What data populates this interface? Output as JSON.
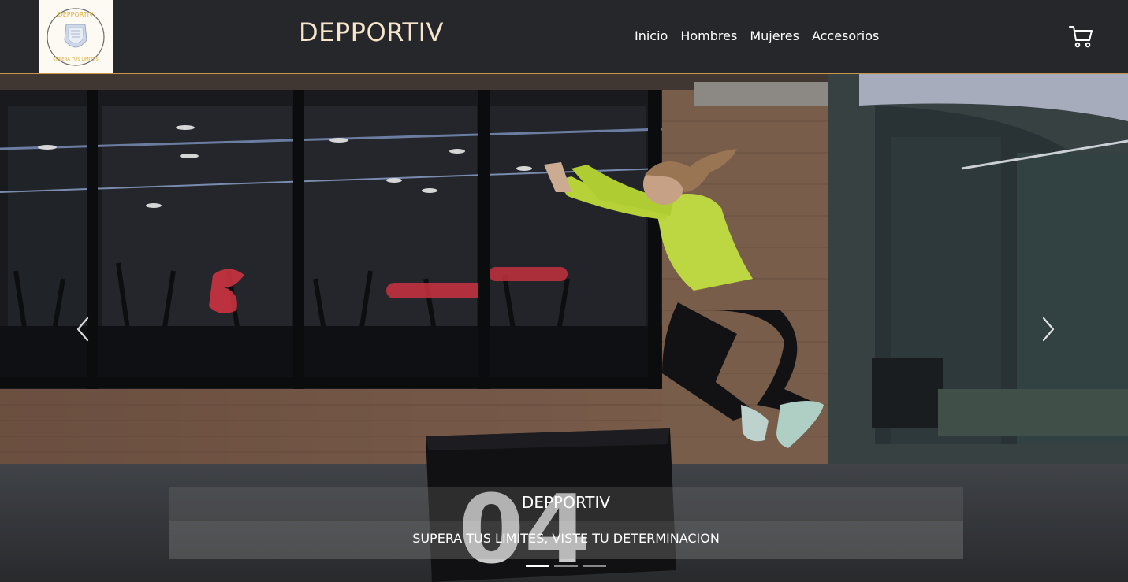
{
  "header": {
    "logo": {
      "icon": "depportiv-crest-logo",
      "text_top": "DEPPORTIV",
      "text_bottom": "SUPERA TUS LIMITES"
    },
    "brand": "DEPPORTIV",
    "nav": [
      {
        "label": "Inicio"
      },
      {
        "label": "Hombres"
      },
      {
        "label": "Mujeres"
      },
      {
        "label": "Accesorios"
      }
    ],
    "cart_icon": "shopping-cart-icon"
  },
  "carousel": {
    "image": "athlete-box-jump-gym",
    "box_number": "04",
    "caption_title": "DEPPORTIV",
    "caption_text": "SUPERA TUS LIMITES, VISTE TU DETERMINACION",
    "prev_icon": "chevron-left-icon",
    "next_icon": "chevron-right-icon",
    "slides": 3,
    "active_slide": 1
  },
  "colors": {
    "navbar_bg": "#25272a",
    "brand_text": "#f7e6cc",
    "accent_border": "#c8964a",
    "logo_bg": "#fdfaf3",
    "logo_gold": "#e0b040"
  }
}
